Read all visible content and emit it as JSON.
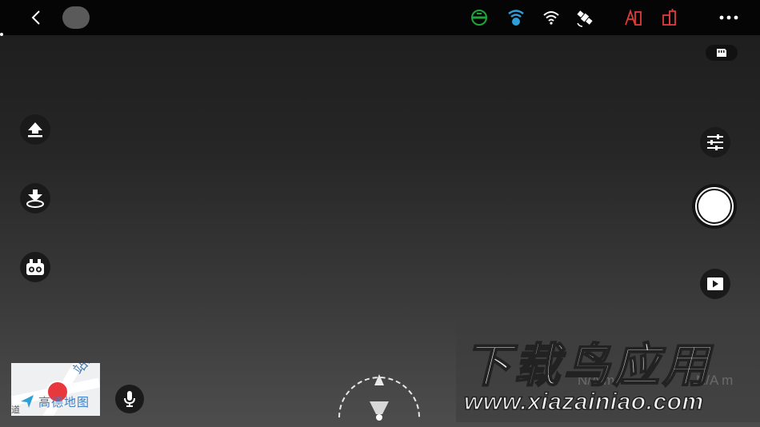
{
  "colors": {
    "background_top": "#1c1c1c",
    "background_bottom": "#4d4d4d",
    "status_ok": "#1fa33a",
    "status_warn": "#e23b3b",
    "signal_blue": "#2e9fd8",
    "map_red": "#e8383d",
    "map_blue": "#3d7ec9"
  },
  "topbar": {
    "back_icon": "chevron-left-icon",
    "mode_indicator": "mode-pill",
    "status_icons": [
      "gps-status-icon",
      "remote-signal-icon",
      "wifi-icon",
      "satellite-icon",
      "aircraft-battery-icon",
      "remote-battery-icon"
    ],
    "more_icon": "more-dots-icon"
  },
  "left_controls": [
    "takeoff-icon",
    "landing-icon",
    "vision-sensor-icon"
  ],
  "right_controls": [
    "camera-settings-icon",
    "shutter-button",
    "playback-icon"
  ],
  "storage_badge_icon": "sd-card-icon",
  "minimap": {
    "street_label": "站东",
    "brand": "高德地图",
    "edge_text": "道"
  },
  "mic_icon": "microphone-icon",
  "compass_icon": "attitude-compass-icon",
  "watermark": {
    "title": "下载鸟应用",
    "url": "www.xiazainiao.com",
    "ghost_left": "N/A m/s",
    "ghost_right": "N/A m"
  }
}
